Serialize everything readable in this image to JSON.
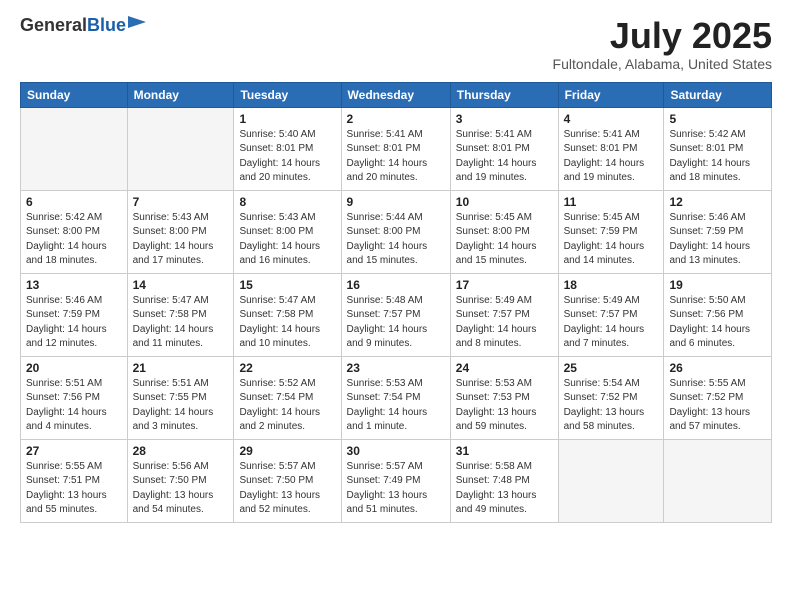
{
  "logo": {
    "general": "General",
    "blue": "Blue"
  },
  "title": "July 2025",
  "location": "Fultondale, Alabama, United States",
  "days_of_week": [
    "Sunday",
    "Monday",
    "Tuesday",
    "Wednesday",
    "Thursday",
    "Friday",
    "Saturday"
  ],
  "weeks": [
    [
      {
        "day": "",
        "sunrise": "",
        "sunset": "",
        "daylight": "",
        "empty": true
      },
      {
        "day": "",
        "sunrise": "",
        "sunset": "",
        "daylight": "",
        "empty": true
      },
      {
        "day": "1",
        "sunrise": "Sunrise: 5:40 AM",
        "sunset": "Sunset: 8:01 PM",
        "daylight": "Daylight: 14 hours and 20 minutes."
      },
      {
        "day": "2",
        "sunrise": "Sunrise: 5:41 AM",
        "sunset": "Sunset: 8:01 PM",
        "daylight": "Daylight: 14 hours and 20 minutes."
      },
      {
        "day": "3",
        "sunrise": "Sunrise: 5:41 AM",
        "sunset": "Sunset: 8:01 PM",
        "daylight": "Daylight: 14 hours and 19 minutes."
      },
      {
        "day": "4",
        "sunrise": "Sunrise: 5:41 AM",
        "sunset": "Sunset: 8:01 PM",
        "daylight": "Daylight: 14 hours and 19 minutes."
      },
      {
        "day": "5",
        "sunrise": "Sunrise: 5:42 AM",
        "sunset": "Sunset: 8:01 PM",
        "daylight": "Daylight: 14 hours and 18 minutes."
      }
    ],
    [
      {
        "day": "6",
        "sunrise": "Sunrise: 5:42 AM",
        "sunset": "Sunset: 8:00 PM",
        "daylight": "Daylight: 14 hours and 18 minutes."
      },
      {
        "day": "7",
        "sunrise": "Sunrise: 5:43 AM",
        "sunset": "Sunset: 8:00 PM",
        "daylight": "Daylight: 14 hours and 17 minutes."
      },
      {
        "day": "8",
        "sunrise": "Sunrise: 5:43 AM",
        "sunset": "Sunset: 8:00 PM",
        "daylight": "Daylight: 14 hours and 16 minutes."
      },
      {
        "day": "9",
        "sunrise": "Sunrise: 5:44 AM",
        "sunset": "Sunset: 8:00 PM",
        "daylight": "Daylight: 14 hours and 15 minutes."
      },
      {
        "day": "10",
        "sunrise": "Sunrise: 5:45 AM",
        "sunset": "Sunset: 8:00 PM",
        "daylight": "Daylight: 14 hours and 15 minutes."
      },
      {
        "day": "11",
        "sunrise": "Sunrise: 5:45 AM",
        "sunset": "Sunset: 7:59 PM",
        "daylight": "Daylight: 14 hours and 14 minutes."
      },
      {
        "day": "12",
        "sunrise": "Sunrise: 5:46 AM",
        "sunset": "Sunset: 7:59 PM",
        "daylight": "Daylight: 14 hours and 13 minutes."
      }
    ],
    [
      {
        "day": "13",
        "sunrise": "Sunrise: 5:46 AM",
        "sunset": "Sunset: 7:59 PM",
        "daylight": "Daylight: 14 hours and 12 minutes."
      },
      {
        "day": "14",
        "sunrise": "Sunrise: 5:47 AM",
        "sunset": "Sunset: 7:58 PM",
        "daylight": "Daylight: 14 hours and 11 minutes."
      },
      {
        "day": "15",
        "sunrise": "Sunrise: 5:47 AM",
        "sunset": "Sunset: 7:58 PM",
        "daylight": "Daylight: 14 hours and 10 minutes."
      },
      {
        "day": "16",
        "sunrise": "Sunrise: 5:48 AM",
        "sunset": "Sunset: 7:57 PM",
        "daylight": "Daylight: 14 hours and 9 minutes."
      },
      {
        "day": "17",
        "sunrise": "Sunrise: 5:49 AM",
        "sunset": "Sunset: 7:57 PM",
        "daylight": "Daylight: 14 hours and 8 minutes."
      },
      {
        "day": "18",
        "sunrise": "Sunrise: 5:49 AM",
        "sunset": "Sunset: 7:57 PM",
        "daylight": "Daylight: 14 hours and 7 minutes."
      },
      {
        "day": "19",
        "sunrise": "Sunrise: 5:50 AM",
        "sunset": "Sunset: 7:56 PM",
        "daylight": "Daylight: 14 hours and 6 minutes."
      }
    ],
    [
      {
        "day": "20",
        "sunrise": "Sunrise: 5:51 AM",
        "sunset": "Sunset: 7:56 PM",
        "daylight": "Daylight: 14 hours and 4 minutes."
      },
      {
        "day": "21",
        "sunrise": "Sunrise: 5:51 AM",
        "sunset": "Sunset: 7:55 PM",
        "daylight": "Daylight: 14 hours and 3 minutes."
      },
      {
        "day": "22",
        "sunrise": "Sunrise: 5:52 AM",
        "sunset": "Sunset: 7:54 PM",
        "daylight": "Daylight: 14 hours and 2 minutes."
      },
      {
        "day": "23",
        "sunrise": "Sunrise: 5:53 AM",
        "sunset": "Sunset: 7:54 PM",
        "daylight": "Daylight: 14 hours and 1 minute."
      },
      {
        "day": "24",
        "sunrise": "Sunrise: 5:53 AM",
        "sunset": "Sunset: 7:53 PM",
        "daylight": "Daylight: 13 hours and 59 minutes."
      },
      {
        "day": "25",
        "sunrise": "Sunrise: 5:54 AM",
        "sunset": "Sunset: 7:52 PM",
        "daylight": "Daylight: 13 hours and 58 minutes."
      },
      {
        "day": "26",
        "sunrise": "Sunrise: 5:55 AM",
        "sunset": "Sunset: 7:52 PM",
        "daylight": "Daylight: 13 hours and 57 minutes."
      }
    ],
    [
      {
        "day": "27",
        "sunrise": "Sunrise: 5:55 AM",
        "sunset": "Sunset: 7:51 PM",
        "daylight": "Daylight: 13 hours and 55 minutes."
      },
      {
        "day": "28",
        "sunrise": "Sunrise: 5:56 AM",
        "sunset": "Sunset: 7:50 PM",
        "daylight": "Daylight: 13 hours and 54 minutes."
      },
      {
        "day": "29",
        "sunrise": "Sunrise: 5:57 AM",
        "sunset": "Sunset: 7:50 PM",
        "daylight": "Daylight: 13 hours and 52 minutes."
      },
      {
        "day": "30",
        "sunrise": "Sunrise: 5:57 AM",
        "sunset": "Sunset: 7:49 PM",
        "daylight": "Daylight: 13 hours and 51 minutes."
      },
      {
        "day": "31",
        "sunrise": "Sunrise: 5:58 AM",
        "sunset": "Sunset: 7:48 PM",
        "daylight": "Daylight: 13 hours and 49 minutes."
      },
      {
        "day": "",
        "sunrise": "",
        "sunset": "",
        "daylight": "",
        "empty": true
      },
      {
        "day": "",
        "sunrise": "",
        "sunset": "",
        "daylight": "",
        "empty": true
      }
    ]
  ]
}
